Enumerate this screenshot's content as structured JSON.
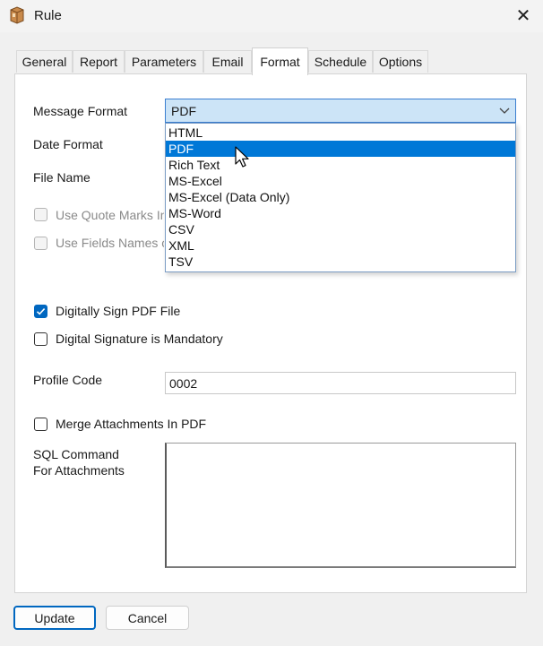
{
  "window": {
    "title": "Rule",
    "close_symbol": "✕",
    "app_icon": "package-icon"
  },
  "tabs": [
    {
      "label": "General"
    },
    {
      "label": "Report"
    },
    {
      "label": "Parameters"
    },
    {
      "label": "Email"
    },
    {
      "label": "Format"
    },
    {
      "label": "Schedule"
    },
    {
      "label": "Options"
    }
  ],
  "active_tab": "Format",
  "format": {
    "message_format_label": "Message Format",
    "message_format_value": "PDF",
    "message_format_options": [
      "HTML",
      "PDF",
      "Rich Text",
      "MS-Excel",
      "MS-Excel (Data Only)",
      "MS-Word",
      "CSV",
      "XML",
      "TSV"
    ],
    "highlighted_option": "PDF",
    "date_format_label": "Date Format",
    "file_name_label": "File Name",
    "use_quote_marks_label": "Use Quote Marks In",
    "use_quote_marks_checked": false,
    "use_fields_names_label": "Use Fields Names o",
    "use_fields_names_checked": false,
    "digitally_sign_label": "Digitally Sign PDF File",
    "digitally_sign_checked": true,
    "signature_mandatory_label": "Digital Signature is Mandatory",
    "signature_mandatory_checked": false,
    "profile_code_label": "Profile Code",
    "profile_code_value": "0002",
    "merge_attachments_label": "Merge Attachments In PDF",
    "merge_attachments_checked": false,
    "sql_command_label_line1": "SQL Command",
    "sql_command_label_line2": "For Attachments",
    "sql_command_value": ""
  },
  "footer": {
    "update_label": "Update",
    "cancel_label": "Cancel"
  },
  "colors": {
    "accent": "#0067c0",
    "selection": "#0078d7",
    "combo_bg": "#cce4f7"
  }
}
